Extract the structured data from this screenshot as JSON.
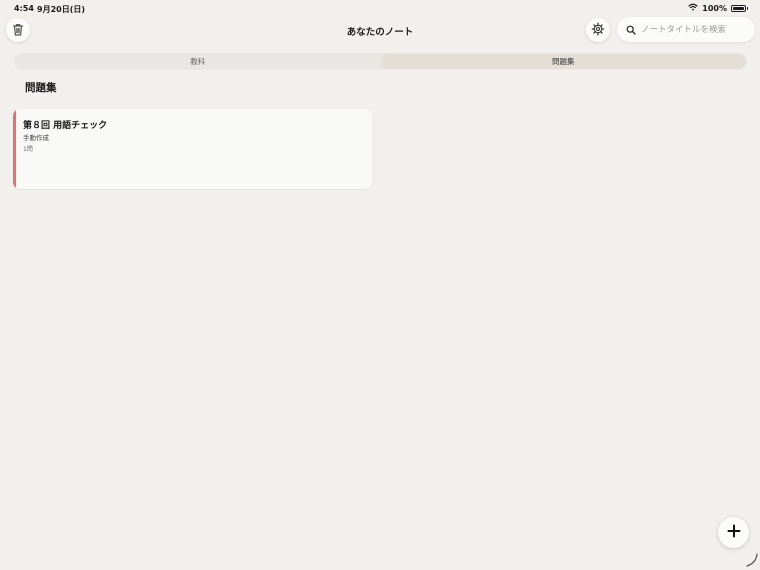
{
  "status_bar": {
    "time": "4:54",
    "date": "9月20日(日)",
    "battery": "100%",
    "battery_level": 1.0,
    "wifi_icon": "wifi-icon",
    "battery_icon": "battery-icon"
  },
  "nav": {
    "title": "あなたのノート",
    "trash_icon": "trash-icon",
    "gear_icon": "gear-icon"
  },
  "search": {
    "placeholder": "ノートタイトルを検索",
    "value": "",
    "icon": "search-icon"
  },
  "segments": {
    "items": [
      {
        "label": "教科",
        "selected": false
      },
      {
        "label": "問題集",
        "selected": true
      }
    ]
  },
  "section": {
    "title": "問題集"
  },
  "cards": [
    {
      "title": "第８回 用語チェック",
      "subtitle": "手動作成",
      "count": "1問",
      "accent_color": "#e86f6f"
    }
  ],
  "fab": {
    "icon": "plus-icon"
  },
  "colors": {
    "background": "#f1f0ed",
    "card": "#f9f9f7",
    "accent": "#e86f6f"
  }
}
